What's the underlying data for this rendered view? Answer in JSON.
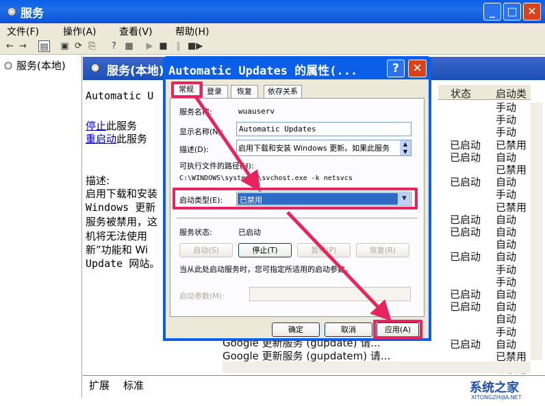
{
  "window": {
    "title": "服务",
    "min": "_",
    "max": "□",
    "close": "✕"
  },
  "menu": [
    "文件(F)",
    "操作(A)",
    "查看(V)",
    "帮助(H)"
  ],
  "tree": {
    "root": "服务(本地)"
  },
  "panel": {
    "header": "服务(本地)",
    "service_name": "Automatic U",
    "stop_link": "停止",
    "stop_suffix": "此服务",
    "restart_link": "重启动",
    "restart_suffix": "此服务",
    "desc_label": "描述:",
    "desc_lines": [
      "启用下载和安装",
      "Windows 更新",
      "服务被禁用，这",
      "机将无法使用",
      "新”功能和 Wi",
      "Update 网站。"
    ]
  },
  "columns": {
    "status": "状态",
    "startup": "启动类"
  },
  "rows": [
    {
      "status": "",
      "startup": "手动"
    },
    {
      "status": "",
      "startup": "手动"
    },
    {
      "status": "",
      "startup": "手动"
    },
    {
      "status": "已启动",
      "startup": "已禁用"
    },
    {
      "status": "已启动",
      "startup": "自动"
    },
    {
      "status": "",
      "startup": "已禁用"
    },
    {
      "status": "已启动",
      "startup": "自动"
    },
    {
      "status": "",
      "startup": "手动"
    },
    {
      "status": "",
      "startup": "已禁用"
    },
    {
      "status": "已启动",
      "startup": "自动"
    },
    {
      "status": "已启动",
      "startup": "自动"
    },
    {
      "status": "",
      "startup": "自动"
    },
    {
      "status": "已启动",
      "startup": "自动"
    },
    {
      "status": "",
      "startup": "手动"
    },
    {
      "status": "",
      "startup": "手动"
    },
    {
      "status": "已启动",
      "startup": "自动"
    },
    {
      "status": "已启动",
      "startup": "自动"
    },
    {
      "status": "",
      "startup": "自动"
    },
    {
      "status": "",
      "startup": "手动"
    },
    {
      "status": "已启动",
      "startup": "自动"
    },
    {
      "status": "",
      "startup": "已禁用"
    },
    {
      "status": "",
      "startup": "已禁用"
    }
  ],
  "google_rows": [
    {
      "name": "Google 更新服务 (gupdate)",
      "desc": "请..."
    },
    {
      "name": "Google 更新服务 (gupdatem)",
      "desc": "请..."
    }
  ],
  "bottom_tabs": [
    "扩展",
    "标准"
  ],
  "dialog": {
    "title": "Automatic Updates 的属性(...",
    "help": "?",
    "close": "✕",
    "tabs": [
      "常规",
      "登录",
      "恢复",
      "依存关系"
    ],
    "service_name_label": "服务名称:",
    "service_name": "wuauserv",
    "display_name_label": "显示名称(N):",
    "display_name": "Automatic Updates",
    "description_label": "描述(D):",
    "description": "启用下载和安装 Windows 更新。如果此服务",
    "path_label": "可执行文件的路径(H):",
    "path": "C:\\WINDOWS\\system32\\svchost.exe -k netsvcs",
    "startup_type_label": "启动类型(E):",
    "startup_type_value": "已禁用",
    "service_status_label": "服务状态:",
    "service_status": "已启动",
    "start_btn": "启动(S)",
    "stop_btn": "停止(T)",
    "pause_btn": "暂停(P)",
    "resume_btn": "恢复(R)",
    "hint": "当从此处启动服务时，您可指定所适用的启动参数。",
    "params_label": "启动参数(M):",
    "ok": "确定",
    "cancel": "取消",
    "apply": "应用(A)"
  },
  "watermark": {
    "text": "系统之家",
    "sub": "XITONGZHIJIA.NET"
  },
  "colors": {
    "highlight": "#e8245e",
    "xp_blue": "#0a5ee8",
    "selection": "#316ac5"
  }
}
